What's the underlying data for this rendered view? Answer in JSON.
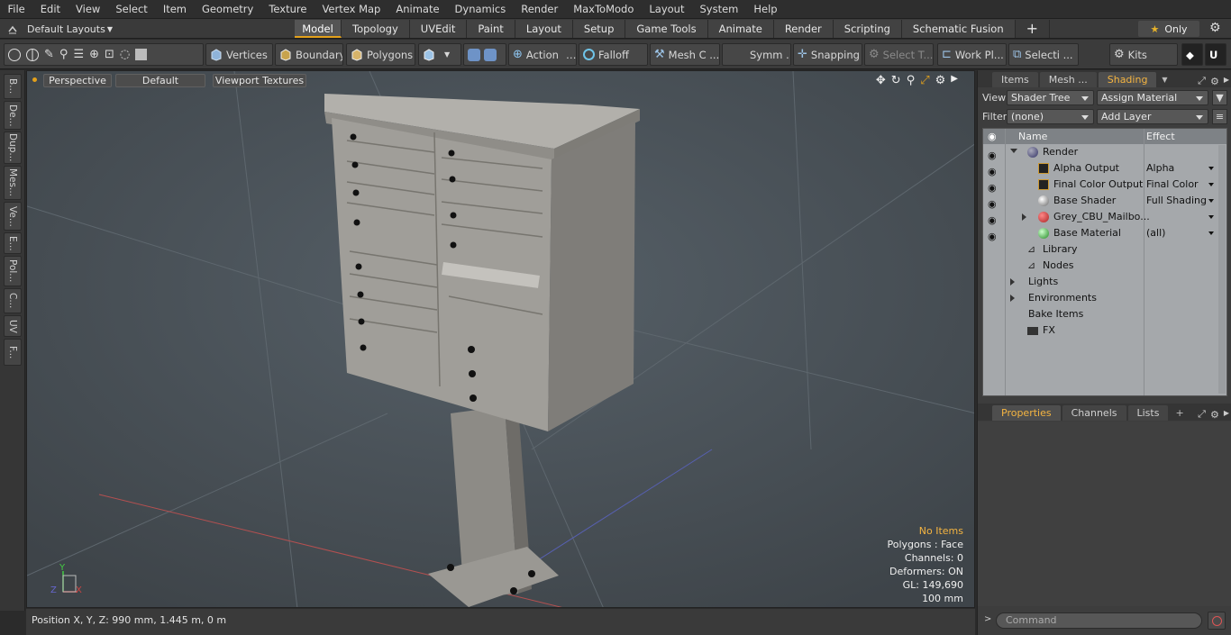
{
  "menu": [
    "File",
    "Edit",
    "View",
    "Select",
    "Item",
    "Geometry",
    "Texture",
    "Vertex Map",
    "Animate",
    "Dynamics",
    "Render",
    "MaxToModo",
    "Layout",
    "System",
    "Help"
  ],
  "layout_selector": "Default Layouts",
  "layout_tabs": [
    "Model",
    "Topology",
    "UVEdit",
    "Paint",
    "Layout",
    "Setup",
    "Game Tools",
    "Animate",
    "Render",
    "Scripting",
    "Schematic Fusion"
  ],
  "only_label": "Only",
  "toolbar": {
    "vertices": "Vertices",
    "boundary": "Boundary",
    "polygons": "Polygons",
    "action": "Action",
    "falloff": "Falloff",
    "mesh": "Mesh C ...",
    "symm": "Symm ...",
    "snapping": "Snapping",
    "select_t": "Select T...",
    "work_pl": "Work Pl...",
    "selecti": "Selecti ...",
    "kits": "Kits"
  },
  "left_tabs": [
    "B...",
    "De...",
    "Dup...",
    "Mes...",
    "Ve...",
    "E...",
    "Pol...",
    "C...",
    "UV",
    "F..."
  ],
  "viewport": {
    "perspective": "Perspective",
    "default": "Default",
    "textures": "Viewport Textures",
    "hud": {
      "no_items": "No Items",
      "polygons": "Polygons : Face",
      "channels": "Channels: 0",
      "deformers": "Deformers: ON",
      "gl": "GL: 149,690",
      "scale": "100 mm"
    }
  },
  "status": "Position X, Y, Z:  990 mm, 1.445 m, 0 m",
  "right": {
    "tabs": [
      "Items",
      "Mesh ...",
      "Shading"
    ],
    "view_label": "View",
    "view_value": "Shader Tree",
    "assign": "Assign Material",
    "filter_label": "Filter",
    "filter_value": "(none)",
    "add_layer": "Add Layer",
    "col_name": "Name",
    "col_effect": "Effect",
    "rows": [
      {
        "name": "Render",
        "effect": ""
      },
      {
        "name": "Alpha Output",
        "effect": "Alpha"
      },
      {
        "name": "Final Color Output",
        "effect": "Final Color"
      },
      {
        "name": "Base Shader",
        "effect": "Full Shading"
      },
      {
        "name": "Grey_CBU_Mailbo...",
        "effect": ""
      },
      {
        "name": "Base Material",
        "effect": "(all)"
      },
      {
        "name": "Library",
        "effect": ""
      },
      {
        "name": "Nodes",
        "effect": ""
      },
      {
        "name": "Lights",
        "effect": ""
      },
      {
        "name": "Environments",
        "effect": ""
      },
      {
        "name": "Bake Items",
        "effect": ""
      },
      {
        "name": "FX",
        "effect": ""
      }
    ],
    "bottom_tabs": [
      "Properties",
      "Channels",
      "Lists"
    ],
    "command_placeholder": "Command"
  },
  "colors": {
    "accent": "#e3a11b",
    "viewport_bg": "#4b5258",
    "tree_bg": "#a5a8ab"
  }
}
